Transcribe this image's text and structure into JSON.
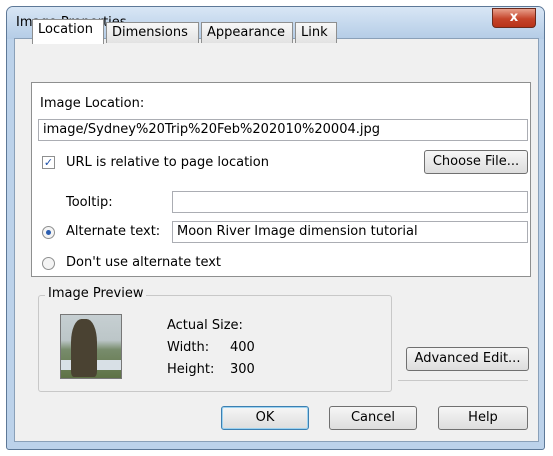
{
  "window": {
    "title": "Image Properties",
    "close_label": "x"
  },
  "tabs": [
    "Location",
    "Dimensions",
    "Appearance",
    "Link"
  ],
  "location": {
    "image_location_label": "Image Location:",
    "image_location_value": "image/Sydney%20Trip%20Feb%202010%20004.jpg",
    "url_relative_label": "URL is relative to page location",
    "url_relative_checked": true,
    "choose_file_label": "Choose File...",
    "tooltip_label": "Tooltip:",
    "tooltip_value": "",
    "alternate_text_label": "Alternate text:",
    "alternate_text_value": "Moon River Image dimension tutorial",
    "alt_selected": true,
    "no_alt_label": "Don't use alternate text"
  },
  "preview": {
    "group_label": "Image Preview",
    "actual_size_label": "Actual Size:",
    "width_label": "Width:",
    "width_value": "400",
    "height_label": "Height:",
    "height_value": "300"
  },
  "buttons": {
    "advanced_edit": "Advanced Edit...",
    "ok": "OK",
    "cancel": "Cancel",
    "help": "Help"
  }
}
